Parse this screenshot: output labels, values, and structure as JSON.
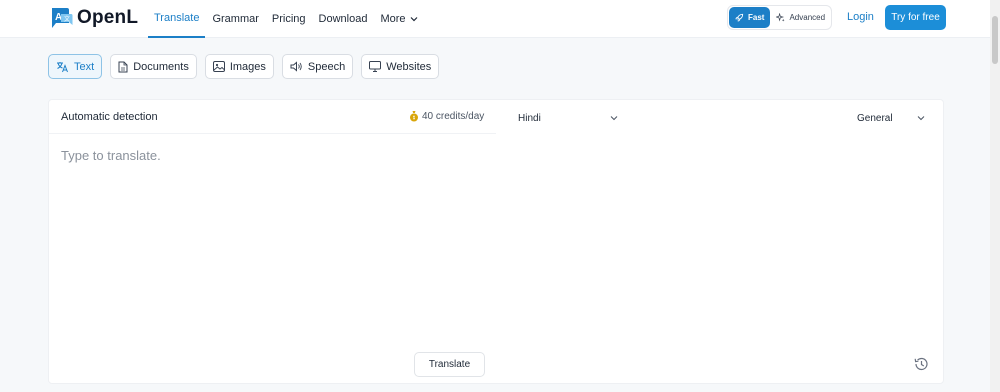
{
  "app": {
    "name": "OpenL"
  },
  "header": {
    "nav": [
      {
        "label": "Translate",
        "active": true
      },
      {
        "label": "Grammar"
      },
      {
        "label": "Pricing"
      },
      {
        "label": "Download"
      },
      {
        "label": "More"
      }
    ],
    "mode": {
      "fast_label": "Fast",
      "advanced_label": "Advanced",
      "selected": "Fast"
    },
    "login_label": "Login",
    "try_label": "Try for free"
  },
  "tabs": [
    {
      "label": "Text",
      "icon": "translate-icon",
      "active": true
    },
    {
      "label": "Documents",
      "icon": "document-icon"
    },
    {
      "label": "Images",
      "icon": "image-icon"
    },
    {
      "label": "Speech",
      "icon": "speaker-icon"
    },
    {
      "label": "Websites",
      "icon": "monitor-icon"
    }
  ],
  "translator": {
    "source_language": "Automatic detection",
    "credits": "40 credits/day",
    "target_language": "Hindi",
    "domain": "General",
    "input_placeholder": "Type to translate.",
    "translate_label": "Translate"
  },
  "colors": {
    "accent": "#1c7fc7",
    "primary_button": "#1c8ed8",
    "background": "#f6f8fa",
    "credits_icon": "#d9a60a"
  }
}
